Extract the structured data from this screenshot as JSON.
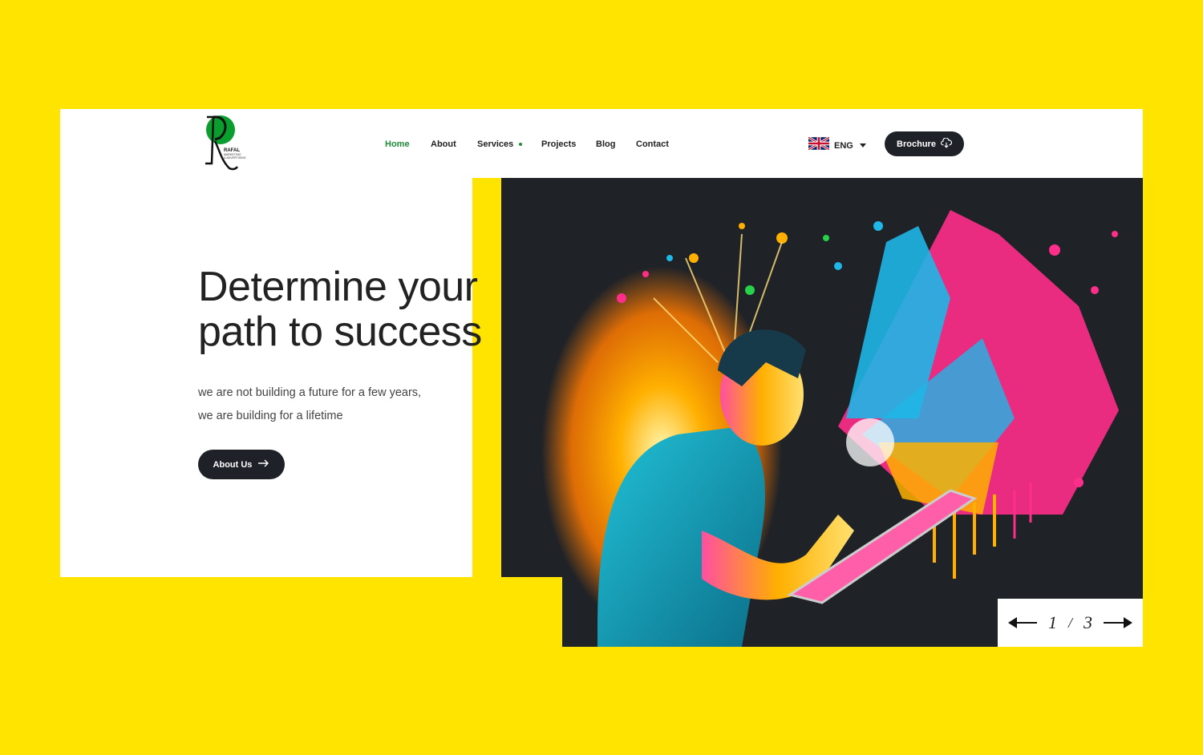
{
  "header": {
    "logo": {
      "brand_name": "RAFAL",
      "tagline": "MARKETING & ADVERTISING"
    },
    "nav": [
      {
        "label": "Home",
        "active": true
      },
      {
        "label": "About",
        "active": false
      },
      {
        "label": "Services",
        "active": false,
        "has_dropdown_dot": true
      },
      {
        "label": "Projects",
        "active": false
      },
      {
        "label": "Blog",
        "active": false
      },
      {
        "label": "Contact",
        "active": false
      }
    ],
    "language": {
      "label": "ENG",
      "flag": "uk-flag-icon"
    },
    "brochure_label": "Brochure",
    "brochure_icon": "cloud-download-icon"
  },
  "hero": {
    "title_line1": "Determine your",
    "title_line2": "path to success",
    "subtitle_line1": "we are not building a future for a few years,",
    "subtitle_line2": "we are building for a lifetime",
    "cta_label": "About Us",
    "cta_icon": "arrow-right-icon",
    "image": "paint-splash-artist-illustration"
  },
  "slider": {
    "current": "1",
    "separator": "/",
    "total": "3",
    "prev_icon": "arrow-left-icon",
    "next_icon": "arrow-right-icon"
  },
  "colors": {
    "background": "#FFE400",
    "accent_green": "#1f8a3a",
    "dark_button": "#1e2128",
    "image_bg": "#1f2227"
  }
}
